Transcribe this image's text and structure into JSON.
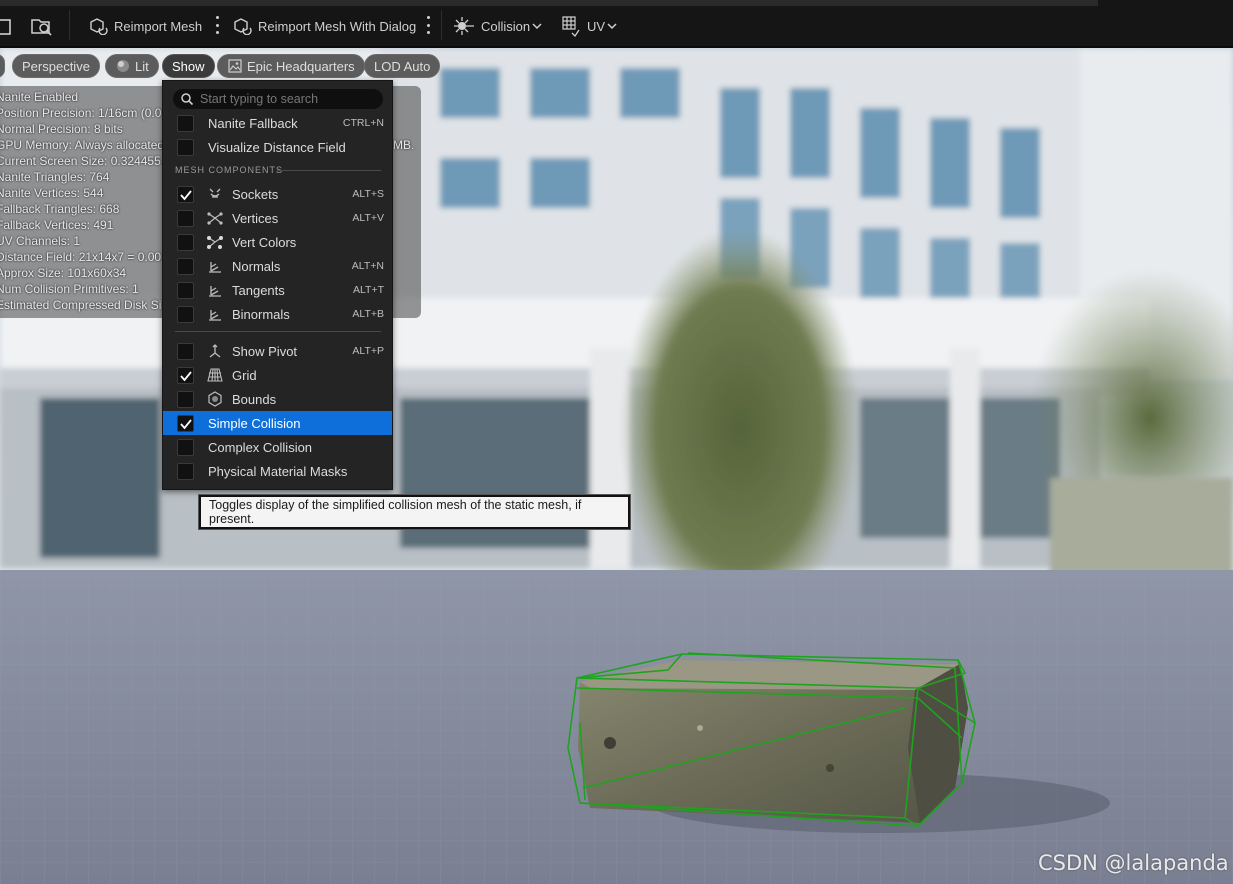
{
  "toolbar": {
    "reimport_label": "Reimport Mesh",
    "reimport_dialog_label": "Reimport Mesh With Dialog",
    "collision_label": "Collision",
    "uv_label": "UV"
  },
  "viewport_bar": {
    "perspective_label": "Perspective",
    "lit_label": "Lit",
    "show_label": "Show",
    "environment_label": "Epic Headquarters",
    "lod_label": "LOD Auto"
  },
  "stats": [
    "Nanite Enabled",
    "Position Precision: 1/16cm (0.0",
    "Normal Precision: 8 bits",
    "GPU Memory: Always allocated",
    "Current Screen Size: 0.324455",
    "Nanite Triangles: 764",
    "Nanite Vertices: 544",
    "Fallback Triangles: 668",
    "Fallback Vertices: 491",
    "UV Channels: 1",
    "Distance Field: 21x14x7 = 0.00",
    "Approx Size: 101x60x34",
    "Num Collision Primitives: 1",
    "Estimated Compressed Disk Si"
  ],
  "stats_overflow": "MB.",
  "show_menu": {
    "search_placeholder": "Start typing to search",
    "section_mesh_components": "MESH COMPONENTS",
    "items_top": [
      {
        "label": "Nanite Fallback",
        "shortcut": "CTRL+N",
        "checked": false
      },
      {
        "label": "Visualize Distance Field",
        "shortcut": "",
        "checked": false
      }
    ],
    "mesh_components": [
      {
        "label": "Sockets",
        "shortcut": "ALT+S",
        "checked": true,
        "icon": "sockets-icon"
      },
      {
        "label": "Vertices",
        "shortcut": "ALT+V",
        "checked": false,
        "icon": "vertices-icon"
      },
      {
        "label": "Vert Colors",
        "shortcut": "",
        "checked": false,
        "icon": "vert-colors-icon"
      },
      {
        "label": "Normals",
        "shortcut": "ALT+N",
        "checked": false,
        "icon": "normals-icon"
      },
      {
        "label": "Tangents",
        "shortcut": "ALT+T",
        "checked": false,
        "icon": "tangents-icon"
      },
      {
        "label": "Binormals",
        "shortcut": "ALT+B",
        "checked": false,
        "icon": "binormals-icon"
      }
    ],
    "other_items": [
      {
        "label": "Show Pivot",
        "shortcut": "ALT+P",
        "checked": false,
        "icon": "pivot-icon"
      },
      {
        "label": "Grid",
        "shortcut": "",
        "checked": true,
        "icon": "grid-icon"
      },
      {
        "label": "Bounds",
        "shortcut": "",
        "checked": false,
        "icon": "bounds-icon"
      }
    ],
    "collision_items": [
      {
        "label": "Simple Collision",
        "checked": true,
        "selected": true
      },
      {
        "label": "Complex Collision",
        "checked": false,
        "selected": false
      },
      {
        "label": "Physical Material Masks",
        "checked": false,
        "selected": false
      }
    ]
  },
  "tooltip": "Toggles display of the simplified collision mesh of the static mesh, if present.",
  "watermark": "CSDN @lalapanda",
  "colors": {
    "selection": "#0f6fda",
    "collision_wireframe": "#1fa31f",
    "menu_bg": "#242424"
  }
}
